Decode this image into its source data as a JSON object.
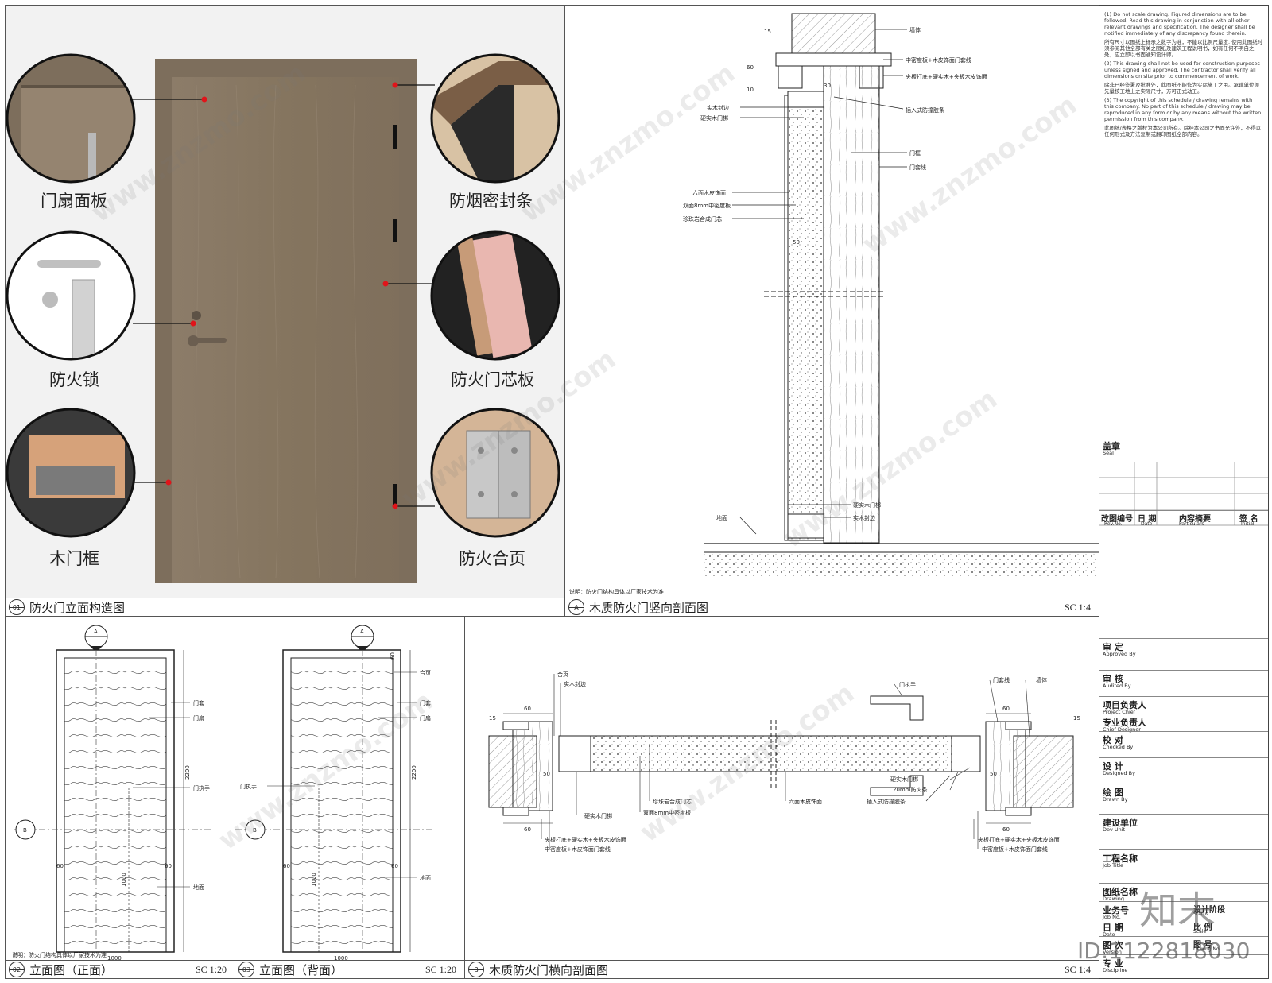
{
  "panels": {
    "elevation_construction": {
      "num": "01",
      "title": "防火门立面构造图"
    },
    "vertical_section": {
      "num": "A",
      "title": "木质防火门竖向剖面图",
      "scale": "SC 1:4"
    },
    "front_elevation": {
      "num": "02",
      "title": "立面图（正面）",
      "scale": "SC 1:20"
    },
    "back_elevation": {
      "num": "03",
      "title": "立面图（背面）",
      "scale": "SC 1:20"
    },
    "horizontal_section": {
      "num": "B",
      "title": "木质防火门横向剖面图",
      "scale": "SC 1:4"
    }
  },
  "callouts": {
    "door_panel": "门扇面板",
    "smoke_seal": "防烟密封条",
    "fire_lock": "防火锁",
    "fire_core": "防火门芯板",
    "wood_frame": "木门框",
    "fire_hinge": "防火合页"
  },
  "vertical_labels": {
    "wall": "墙体",
    "mdf_trim": "中密度板+木皮饰面门套线",
    "plywood": "夹板打底+硬实木+夹板木皮饰面",
    "edge": "实木封边",
    "hard_stile": "硬实木门梆",
    "seal_strip": "插入式防撞胶条",
    "frame": "门框",
    "casing": "门套线",
    "veneer": "六面木皮饰面",
    "mdf8": "双面8mm中密度板",
    "perlite": "珍珠岩合成门芯",
    "hard_stile2": "硬实木门梆",
    "edge2": "实木封边",
    "floor": "地面",
    "note": "说明：防火门结构具体以厂家技术为准",
    "dim15": "15",
    "dim60": "60",
    "dim10": "10",
    "dim50": "50",
    "dim30": "30"
  },
  "front_labels": {
    "casing": "门套",
    "leaf": "门扇",
    "handle": "门执手",
    "floor": "地面",
    "height": "2200",
    "handle_h": "1000",
    "width": "1000",
    "side": "60",
    "note": "说明：防火门结构具体以厂家技术为准",
    "tagA": "A",
    "tagB": "B"
  },
  "back_labels": {
    "hinge": "合页",
    "casing": "门套",
    "leaf": "门扇",
    "handle": "门执手",
    "floor": "地面",
    "height": "2200",
    "handle_h": "1000",
    "width": "1000",
    "side": "60",
    "top": "60",
    "tagA": "A",
    "tagB": "B"
  },
  "horizontal_labels": {
    "hinge": "合页",
    "edge": "实木封边",
    "handle": "门执手",
    "casing": "门套线",
    "wall": "墙体",
    "hard_stile": "硬实木门梆",
    "perlite": "珍珠岩合成门芯",
    "mdf8": "双面8mm中密度板",
    "veneer": "六面木皮饰面",
    "hard_stile2": "硬实木门梆",
    "fire_strip": "20mm防火条",
    "seal": "插入式防撞胶条",
    "plywood": "夹板打底+硬实木+夹板木皮饰面",
    "mdf_trim": "中密度板+木皮饰面门套线",
    "dim60": "60",
    "dim15": "15",
    "dim50": "50"
  },
  "notes": [
    "(1) Do not scale drawing. Figured dimensions are to be followed. Read this drawing in conjunction with all other relevant drawings and specification. The designer shall be notified immediately of any discrepancy found therein.",
    "所有尺寸以图纸上标示之数字为准，不能以比例尺量度. 使用此图纸时须参阅其他全部有关之图纸及建筑工程说明书，如有任何不明白之处，应立即以书面通知设计师。",
    "(2) This drawing shall not be used for construction purposes unless signed and approved. The contractor shall verify all dimensions on site prior to commencement of work.",
    "除非已经签署及批准外，此图纸不能作为实际施工之用。承建单位须先量核工地上之实际尺寸，方可正式动工。",
    "(3) The copyright of this schedule / drawing remains with this company. No part of this schedule / drawing may be reproduced in any form or by any means without the written permission from this company.",
    "此图纸/表格之版权为本公司所有。除经本公司之书面允许外，不得以任何形式及方法复制或翻印图纸全部内容。"
  ],
  "title_block": {
    "seal_cn": "盖章",
    "seal_en": "Seal",
    "rev_cn": "改图编号",
    "rev_en": "Rev.No.",
    "date_cn": "日 期",
    "date_en": "Date",
    "part_cn": "内容摘要",
    "part_en": "Particulars",
    "init_cn": "签 名",
    "init_en": "Initial",
    "rows": [
      {
        "cn": "审 定",
        "en": "Approved By"
      },
      {
        "cn": "审 核",
        "en": "Audited By"
      },
      {
        "cn": "项目负责人",
        "en": "Project Chief"
      },
      {
        "cn": "专业负责人",
        "en": "Chief Designer"
      },
      {
        "cn": "校 对",
        "en": "Checked By"
      },
      {
        "cn": "设 计",
        "en": "Designed By"
      },
      {
        "cn": "绘 图",
        "en": "Drawn By"
      },
      {
        "cn": "建设单位",
        "en": "Dev Unit"
      },
      {
        "cn": "工程名称",
        "en": "Job Title"
      },
      {
        "cn": "图纸名称",
        "en": "Drawing"
      },
      {
        "cn": "业务号",
        "en": "Job No."
      },
      {
        "cn": "日 期",
        "en": "Date"
      },
      {
        "cn": "图 次",
        "en": "Version"
      },
      {
        "cn": "专 业",
        "en": "Discipline"
      }
    ],
    "status_cn": "设计阶段",
    "status_en": "Status",
    "scale_cn": "比 例",
    "scale_en": "Scale",
    "drawno_cn": "图 号",
    "drawno_en": "Dr.wing No."
  },
  "brand": {
    "logo": "知末",
    "id": "ID:1122818030",
    "watermark": "www.znzmo.com"
  },
  "colors": {
    "door": "#8a7a66",
    "frame": "#7d6e5c",
    "red_dot": "#e0141a"
  }
}
